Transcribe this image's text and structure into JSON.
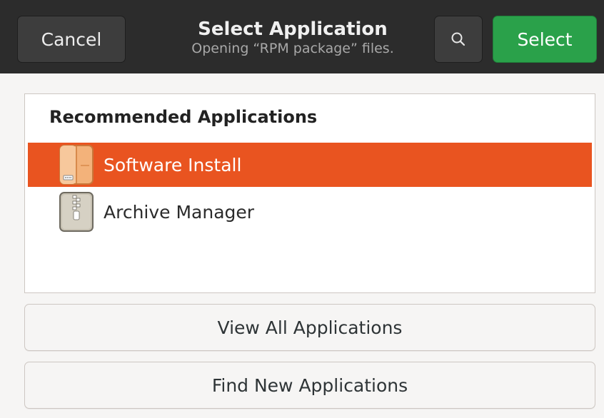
{
  "header": {
    "cancel_label": "Cancel",
    "title": "Select Application",
    "subtitle": "Opening “RPM package” files.",
    "search_icon": "search-icon",
    "select_label": "Select"
  },
  "list": {
    "heading": "Recommended Applications",
    "items": [
      {
        "label": "Software Install",
        "icon": "package-icon",
        "selected": true
      },
      {
        "label": "Archive Manager",
        "icon": "archive-icon",
        "selected": false
      }
    ]
  },
  "actions": {
    "view_all_label": "View All Applications",
    "find_new_label": "Find New Applications"
  },
  "colors": {
    "headerbar": "#2c2c2c",
    "select_button": "#2aa14a",
    "selection": "#e95420"
  }
}
